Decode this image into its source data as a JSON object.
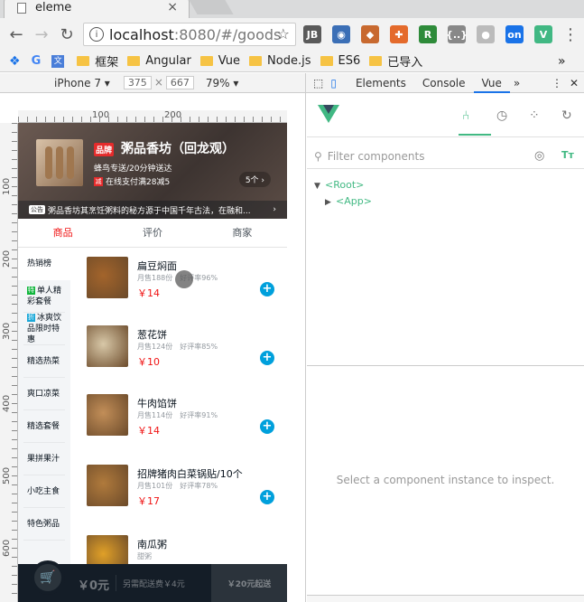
{
  "browser": {
    "tab_title": "eleme",
    "tab_close": "×",
    "url_host": "localhost",
    "url_rest": ":8080/#/goods",
    "bookmarks": [
      "框架",
      "Angular",
      "Vue",
      "Node.js",
      "ES6",
      "已导入"
    ],
    "bookmarks_more": "»",
    "extensions": [
      {
        "name": "jetbrains-ext-icon",
        "label": "JB",
        "color": "#5a5a5a"
      },
      {
        "name": "globe-ext-icon",
        "label": "◉",
        "color": "#3b6fb6"
      },
      {
        "name": "fox-ext-icon",
        "label": "◆",
        "color": "#c8692f"
      },
      {
        "name": "lifesaver-ext-icon",
        "label": "✚",
        "color": "#e46a2b"
      },
      {
        "name": "r-ext-icon",
        "label": "R",
        "color": "#2e8b3a"
      },
      {
        "name": "json-ext-icon",
        "label": "{..}",
        "color": "#888888"
      },
      {
        "name": "grey-ext-icon",
        "label": "●",
        "color": "#bbbbbb"
      },
      {
        "name": "on-ext-icon",
        "label": "on",
        "color": "#1a73e8"
      },
      {
        "name": "vue-ext-icon",
        "label": "V",
        "color": "#41b883"
      }
    ]
  },
  "devices": {
    "device": "iPhone 7",
    "width": "375",
    "times": "×",
    "height": "667",
    "zoom": "79%"
  },
  "ruler": {
    "top_labels": [
      "100",
      "200"
    ],
    "left_labels": [
      "100",
      "200",
      "300",
      "400",
      "500",
      "600"
    ]
  },
  "app": {
    "header": {
      "brand": "品牌",
      "name": "粥品香坊（回龙观）",
      "desc": "蜂鸟专送/20分钟送达",
      "support_icon": "减",
      "support": "在线支付满28减5",
      "count": "5个 ›",
      "bulletin_tag": "公告",
      "bulletin": "粥品香坊其烹饪粥料的秘方源于中国千年古法，在融和...",
      "bulletin_arrow": "›"
    },
    "tabs": [
      "商品",
      "评价",
      "商家"
    ],
    "menu": [
      {
        "tag": "",
        "tag_color": "",
        "label": "热销榜"
      },
      {
        "tag": "特",
        "tag_color": "#10b63c",
        "label": "单人精彩套餐"
      },
      {
        "tag": "折",
        "tag_color": "#1ba8d8",
        "label": "冰爽饮品限时特惠"
      },
      {
        "tag": "",
        "tag_color": "",
        "label": "精选热菜"
      },
      {
        "tag": "",
        "tag_color": "",
        "label": "爽口凉菜"
      },
      {
        "tag": "",
        "tag_color": "",
        "label": "精选套餐"
      },
      {
        "tag": "",
        "tag_color": "",
        "label": "果拼果汁"
      },
      {
        "tag": "",
        "tag_color": "",
        "label": "小吃主食"
      },
      {
        "tag": "",
        "tag_color": "",
        "label": "特色粥品"
      }
    ],
    "foods": [
      {
        "name": "扁豆焖面",
        "sell": "月售188份",
        "rating": "好评率96%",
        "price": "￥14",
        "img_color": "#a3642b"
      },
      {
        "name": "葱花饼",
        "sell": "月售124份",
        "rating": "好评率85%",
        "price": "￥10",
        "img_color": "#d8c8a8"
      },
      {
        "name": "牛肉馅饼",
        "sell": "月售114份",
        "rating": "好评率91%",
        "price": "￥14",
        "img_color": "#c28e58"
      },
      {
        "name": "招牌猪肉白菜锅贴/10个",
        "sell": "月售101份",
        "rating": "好评率78%",
        "price": "￥17",
        "img_color": "#b07a3c"
      },
      {
        "name": "南瓜粥",
        "sell": "甜粥",
        "rating": "",
        "price": "",
        "img_color": "#e0a028"
      }
    ],
    "add_icon": "+",
    "cart": {
      "price": "￥0元",
      "desc": "另需配送费￥4元",
      "pay": "￥20元起送"
    }
  },
  "devtools": {
    "tabs": [
      "Elements",
      "Console",
      "Vue"
    ],
    "more": "»",
    "filter_placeholder": "Filter components",
    "tree": [
      {
        "arrow": "▼",
        "name": "<Root>"
      },
      {
        "arrow": "▶",
        "name": "<App>"
      }
    ],
    "empty_message": "Select a component instance to inspect.",
    "case_toggle": "Tт"
  }
}
